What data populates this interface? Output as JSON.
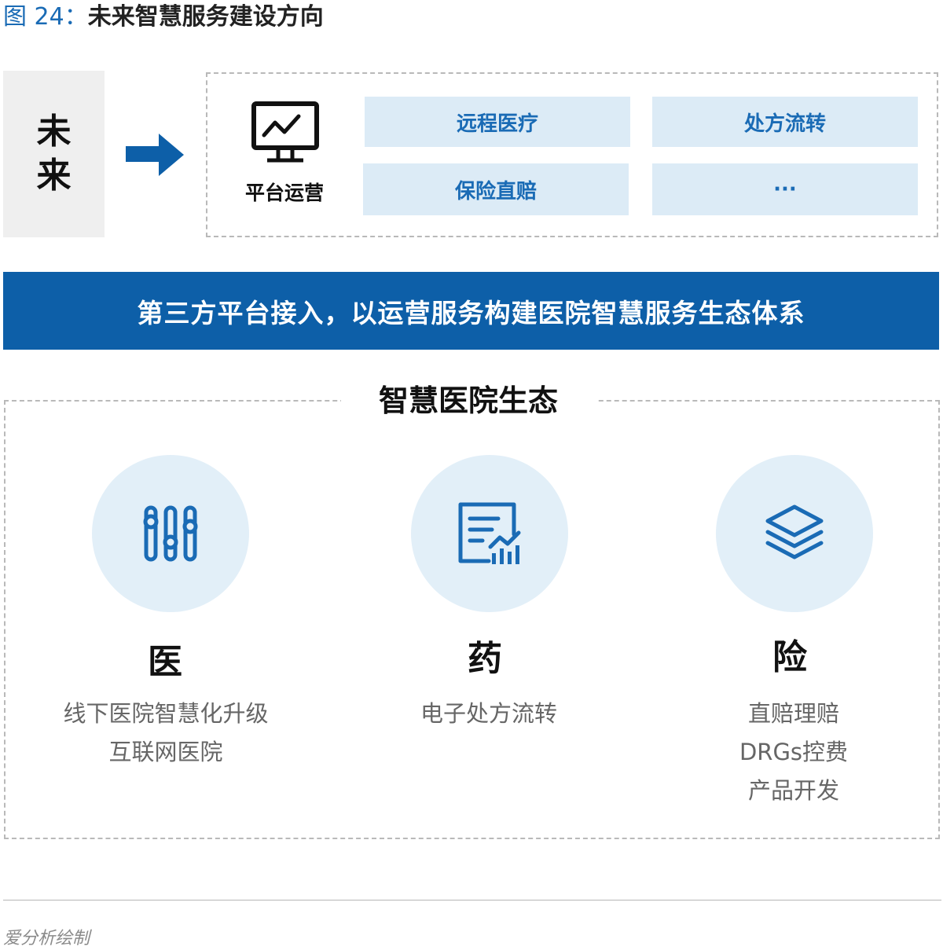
{
  "figure": {
    "label": "图 24：",
    "title": "未来智慧服务建设方向"
  },
  "future": {
    "char1": "未",
    "char2": "来"
  },
  "platform": {
    "label": "平台运营",
    "services": [
      "远程医疗",
      "处方流转",
      "保险直赔",
      "···"
    ]
  },
  "banner": "第三方平台接入，以运营服务构建医院智慧服务生态体系",
  "ecosystem": {
    "title": "智慧医院生态",
    "pillars": [
      {
        "title": "医",
        "icon": "sliders-icon",
        "lines": [
          "线下医院智慧化升级",
          "互联网医院"
        ]
      },
      {
        "title": "药",
        "icon": "prescription-chart-icon",
        "lines": [
          "电子处方流转"
        ]
      },
      {
        "title": "险",
        "icon": "layers-icon",
        "lines": [
          "直赔理赔",
          "DRGs控费",
          "产品开发"
        ]
      }
    ]
  },
  "source": "爱分析绘制",
  "colors": {
    "accent": "#0d5fa8",
    "light_box": "#dcebf6",
    "circle": "#e2eff8",
    "future_bg": "#efefef"
  }
}
